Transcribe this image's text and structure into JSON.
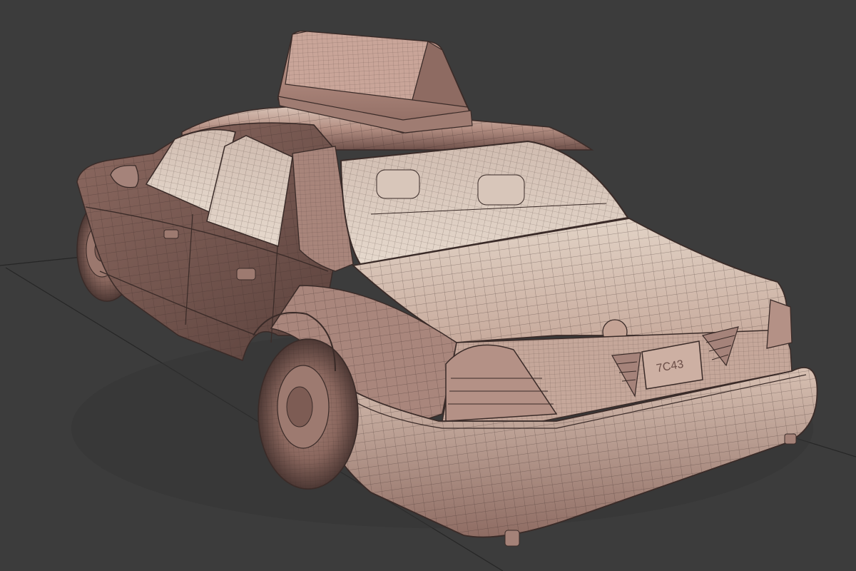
{
  "viewport": {
    "background_color": "#3c3c3c",
    "grid_line_color": "#2a2a2a",
    "render_mode": "wireframe-on-shaded"
  },
  "model": {
    "subject": "taxi-sedan",
    "base_color": "#b58f83",
    "highlight_color": "#e3d0c4",
    "shadow_color": "#5e4540",
    "wire_color": "#3a2b28",
    "license_plate_text": "7C43"
  }
}
